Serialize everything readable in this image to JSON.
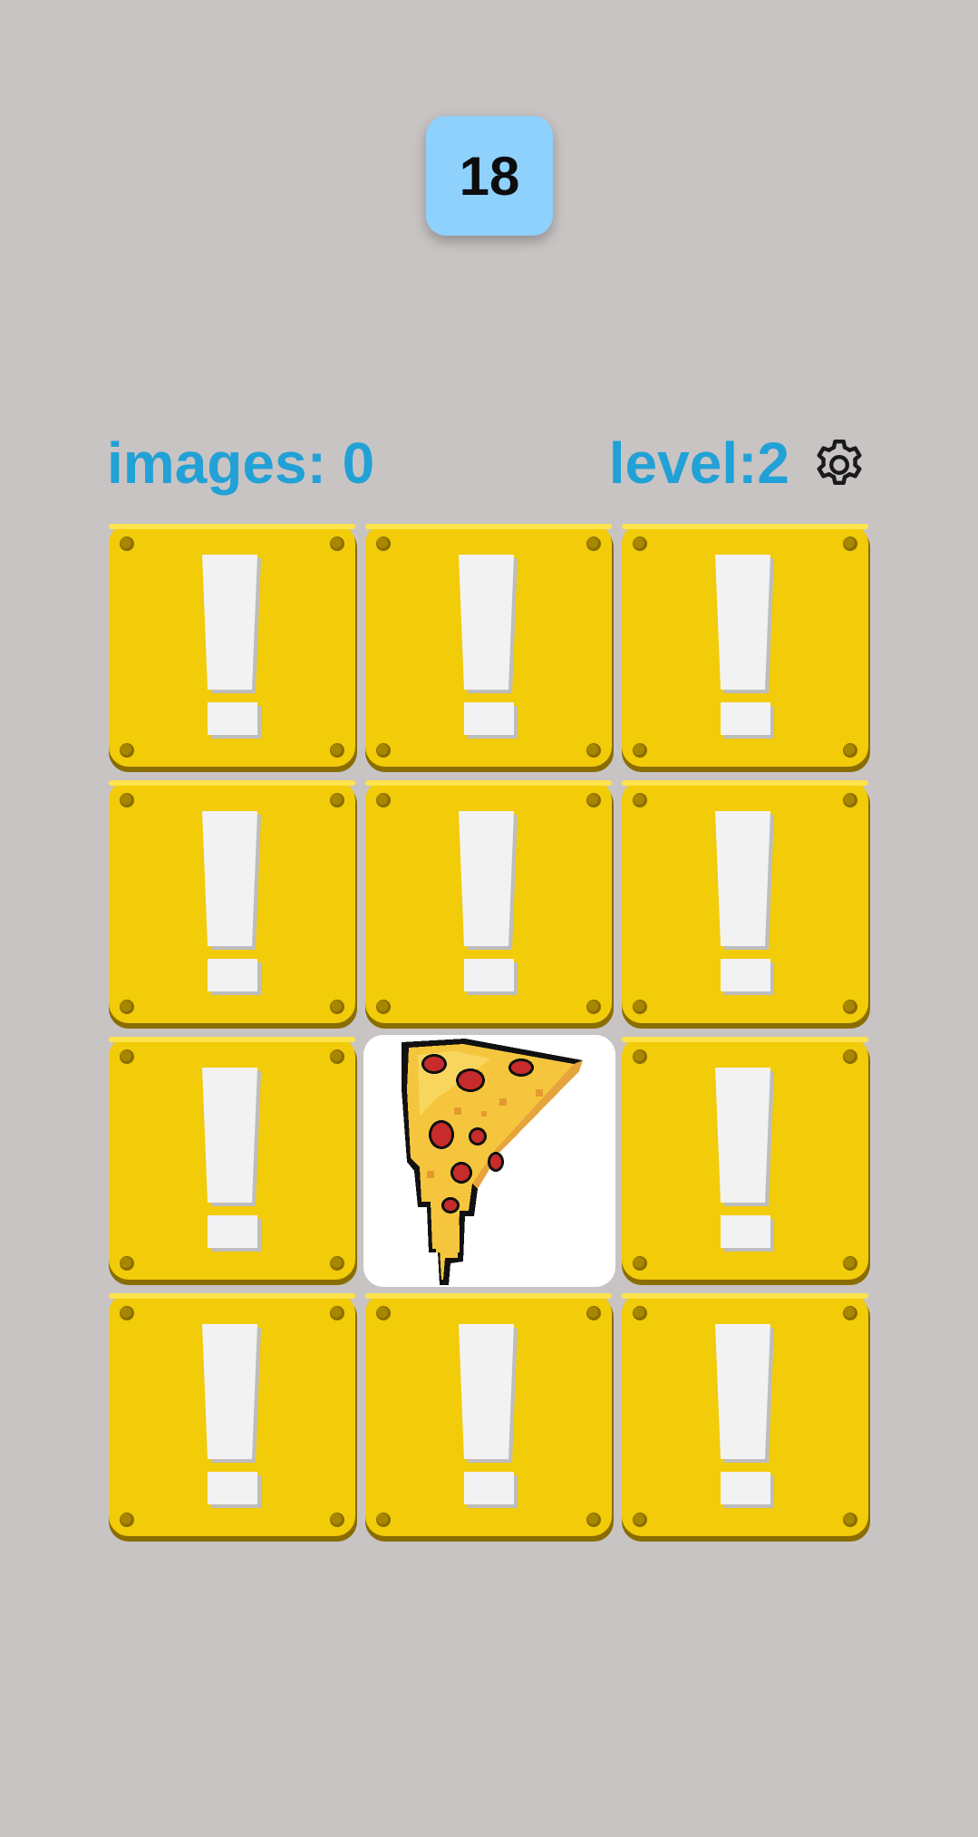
{
  "timer": {
    "value": "18"
  },
  "status": {
    "images_text": "images: 0",
    "level_text": "level:2"
  },
  "settings": {
    "icon": "gear-icon"
  },
  "board": {
    "rows": 4,
    "columns": 3,
    "tiles": [
      {
        "state": "hidden",
        "icon": "exclamation-block-icon"
      },
      {
        "state": "hidden",
        "icon": "exclamation-block-icon"
      },
      {
        "state": "hidden",
        "icon": "exclamation-block-icon"
      },
      {
        "state": "hidden",
        "icon": "exclamation-block-icon"
      },
      {
        "state": "hidden",
        "icon": "exclamation-block-icon"
      },
      {
        "state": "hidden",
        "icon": "exclamation-block-icon"
      },
      {
        "state": "hidden",
        "icon": "exclamation-block-icon"
      },
      {
        "state": "revealed",
        "icon": "pizza-slice-icon"
      },
      {
        "state": "hidden",
        "icon": "exclamation-block-icon"
      },
      {
        "state": "hidden",
        "icon": "exclamation-block-icon"
      },
      {
        "state": "hidden",
        "icon": "exclamation-block-icon"
      },
      {
        "state": "hidden",
        "icon": "exclamation-block-icon"
      }
    ]
  },
  "colors": {
    "background": "#c9c4c4",
    "timer_bg": "#8fd1fd",
    "label_text": "#22a1d6",
    "block_yellow": "#f2cb09",
    "block_dark": "#8a6d00",
    "exclamation": "#f2f2f2"
  }
}
